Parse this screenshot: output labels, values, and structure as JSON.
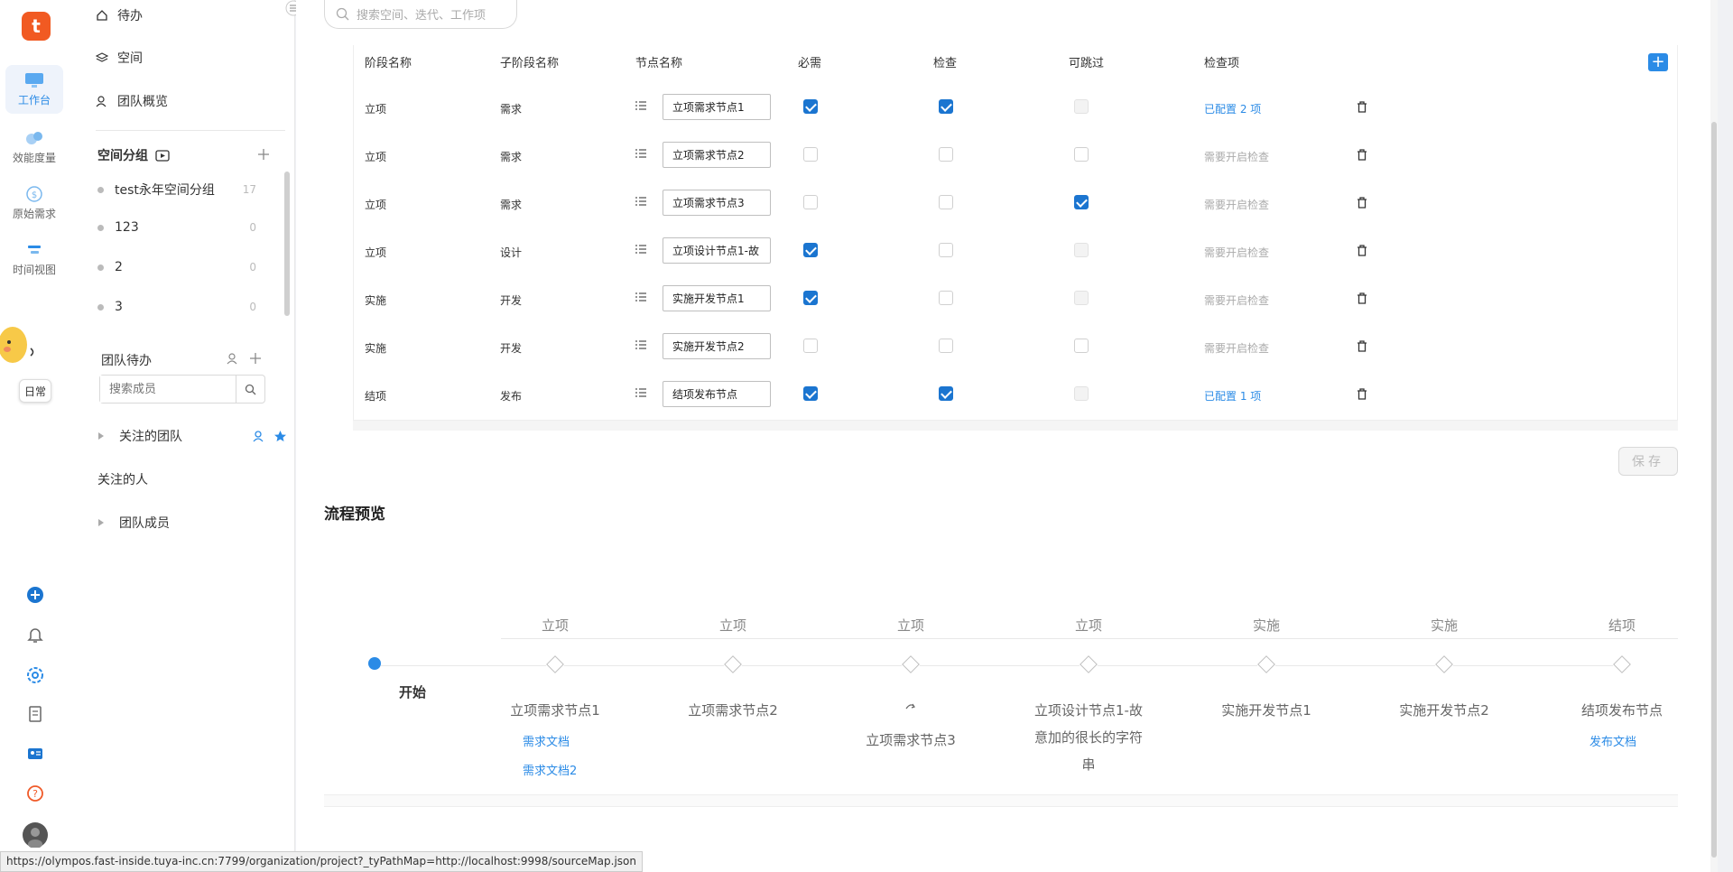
{
  "rail": {
    "logo": "t",
    "items": [
      {
        "label": "工作台",
        "icon": "desktop-icon"
      },
      {
        "label": "效能度量",
        "icon": "metrics-icon"
      },
      {
        "label": "原始需求",
        "icon": "dollar-icon"
      },
      {
        "label": "时间视图",
        "icon": "timeline-icon"
      }
    ],
    "daily_label": "日常",
    "bottom_icons": [
      "add-circle-icon",
      "bell-icon",
      "gear-icon",
      "document-icon",
      "contact-card-icon",
      "help-icon",
      "user-avatar"
    ]
  },
  "sidebar": {
    "nav": [
      {
        "label": "待办",
        "icon": "home-icon"
      },
      {
        "label": "空间",
        "icon": "layers-icon"
      },
      {
        "label": "团队概览",
        "icon": "team-icon"
      }
    ],
    "space_group_title": "空间分组",
    "groups": [
      {
        "name": "test永年空间分组",
        "count": "17"
      },
      {
        "name": "123",
        "count": "0"
      },
      {
        "name": "2",
        "count": "0"
      },
      {
        "name": "3",
        "count": "0"
      }
    ],
    "team_todo_title": "团队待办",
    "member_search_placeholder": "搜索成员",
    "followed_team": "关注的团队",
    "followed_people": "关注的人",
    "team_members": "团队成员"
  },
  "search": {
    "placeholder": "搜索空间、迭代、工作项"
  },
  "table": {
    "headers": [
      "阶段名称",
      "子阶段名称",
      "节点名称",
      "必需",
      "检查",
      "可跳过",
      "检查项"
    ],
    "rows": [
      {
        "stage": "立项",
        "sub": "需求",
        "node": "立项需求节点1",
        "required": true,
        "check": true,
        "skip": "disabled",
        "items": "已配置 2 项",
        "items_active": true
      },
      {
        "stage": "立项",
        "sub": "需求",
        "node": "立项需求节点2",
        "required": false,
        "check": false,
        "skip": "off",
        "items": "需要开启检查",
        "items_active": false
      },
      {
        "stage": "立项",
        "sub": "需求",
        "node": "立项需求节点3",
        "required": false,
        "check": false,
        "skip": "on",
        "items": "需要开启检查",
        "items_active": false
      },
      {
        "stage": "立项",
        "sub": "设计",
        "node": "立项设计节点1-故",
        "required": true,
        "check": false,
        "skip": "disabled",
        "items": "需要开启检查",
        "items_active": false
      },
      {
        "stage": "实施",
        "sub": "开发",
        "node": "实施开发节点1",
        "required": true,
        "check": false,
        "skip": "disabled",
        "items": "需要开启检查",
        "items_active": false
      },
      {
        "stage": "实施",
        "sub": "开发",
        "node": "实施开发节点2",
        "required": false,
        "check": false,
        "skip": "off",
        "items": "需要开启检查",
        "items_active": false
      },
      {
        "stage": "结项",
        "sub": "发布",
        "node": "结项发布节点",
        "required": true,
        "check": true,
        "skip": "disabled",
        "items": "已配置 1 项",
        "items_active": true
      }
    ],
    "add_label": "+",
    "save_label": "保存"
  },
  "preview": {
    "title": "流程预览",
    "start_label": "开始",
    "stages": [
      "立项",
      "立项",
      "立项",
      "立项",
      "实施",
      "实施",
      "结项"
    ],
    "nodes": [
      {
        "name": "立项需求节点1",
        "docs": [
          "需求文档",
          "需求文档2"
        ]
      },
      {
        "name": "立项需求节点2",
        "docs": []
      },
      {
        "name": "立项需求节点3",
        "docs": [],
        "skip_icon": true
      },
      {
        "name": "立项设计节点1-故意加的很长的字符串",
        "docs": []
      },
      {
        "name": "实施开发节点1",
        "docs": []
      },
      {
        "name": "实施开发节点2",
        "docs": []
      },
      {
        "name": "结项发布节点",
        "docs": [
          "发布文档"
        ]
      }
    ]
  },
  "status_url": "https://olympos.fast-inside.tuya-inc.cn:7799/organization/project?_tyPathMap=http://localhost:9998/sourceMap.json",
  "colors": {
    "accent": "#2b8be6",
    "brand": "#f15a22",
    "checkbox": "#1b75d0"
  }
}
